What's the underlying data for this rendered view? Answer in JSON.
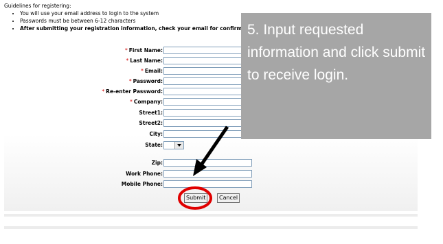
{
  "guidelines": {
    "heading": "Guidelines for registering:",
    "items": [
      "You will use your email address to login to the system",
      "Passwords must be between 6-12 characters",
      "After submitting your registration information, check your email for confirmatic"
    ]
  },
  "form": {
    "required_marker": "*",
    "fields": {
      "first_name": "First Name:",
      "last_name": "Last Name:",
      "email": "Email:",
      "password": "Password:",
      "reenter_password": "Re-enter Password:",
      "company": "Company:",
      "street1": "Street1:",
      "street2": "Street2:",
      "city": "City:",
      "state": "State:",
      "zip": "Zip:",
      "work_phone": "Work Phone:",
      "mobile_phone": "Mobile Phone:"
    },
    "submit_label": "Submit",
    "cancel_label": "Cancel"
  },
  "callout": {
    "text": "5. Input requested information and click submit to receive login."
  },
  "colors": {
    "required": "#d40000",
    "callout_bg": "#a6a6a6",
    "highlight_circle": "#e00000"
  }
}
